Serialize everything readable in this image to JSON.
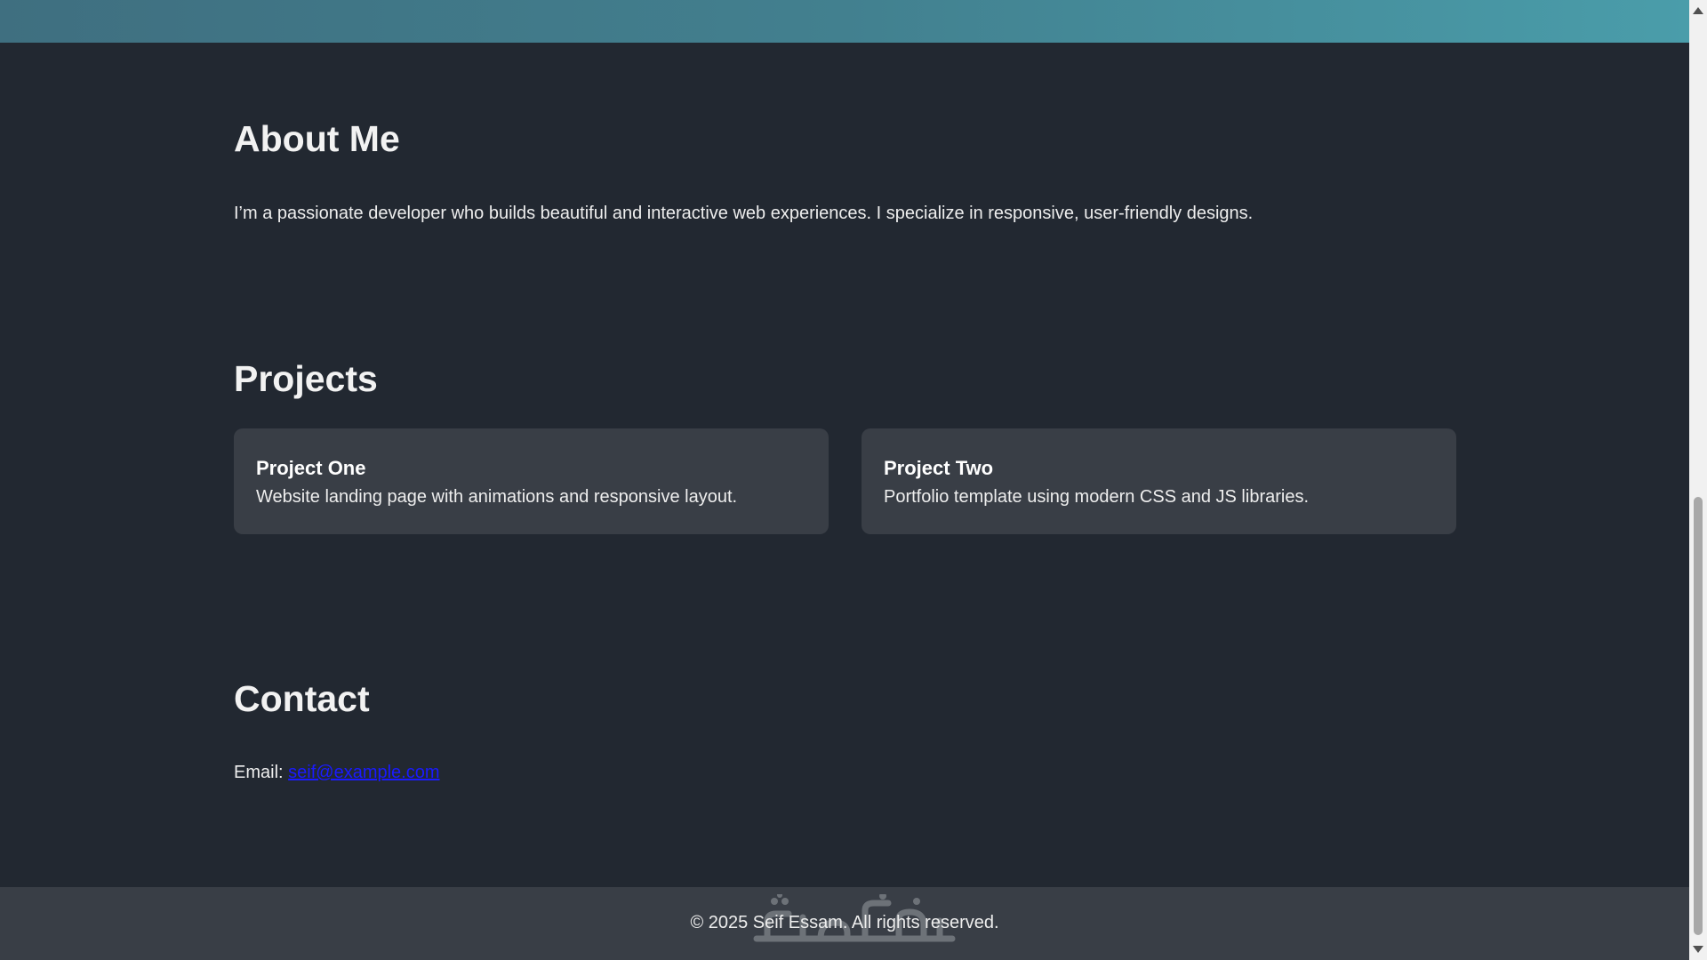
{
  "about": {
    "heading": "About Me",
    "text": "I’m a passionate developer who builds beautiful and interactive web experiences. I specialize in responsive, user-friendly designs."
  },
  "projects": {
    "heading": "Projects",
    "items": [
      {
        "title": "Project One",
        "description": "Website landing page with animations and responsive layout."
      },
      {
        "title": "Project Two",
        "description": "Portfolio template using modern CSS and JS libraries."
      }
    ]
  },
  "contact": {
    "heading": "Contact",
    "email_label": "Email:",
    "email": "seif@example.com"
  },
  "footer": {
    "text": "© 2025 Seif Essam. All rights reserved.",
    "watermark": "خمسات"
  },
  "colors": {
    "background": "#222831",
    "card": "#393e46",
    "header_gradient_start": "#3f6f80",
    "header_gradient_end": "#4a9daa",
    "link": "#1a1aff"
  },
  "scrollbar": {
    "position_fraction": 0.95
  }
}
